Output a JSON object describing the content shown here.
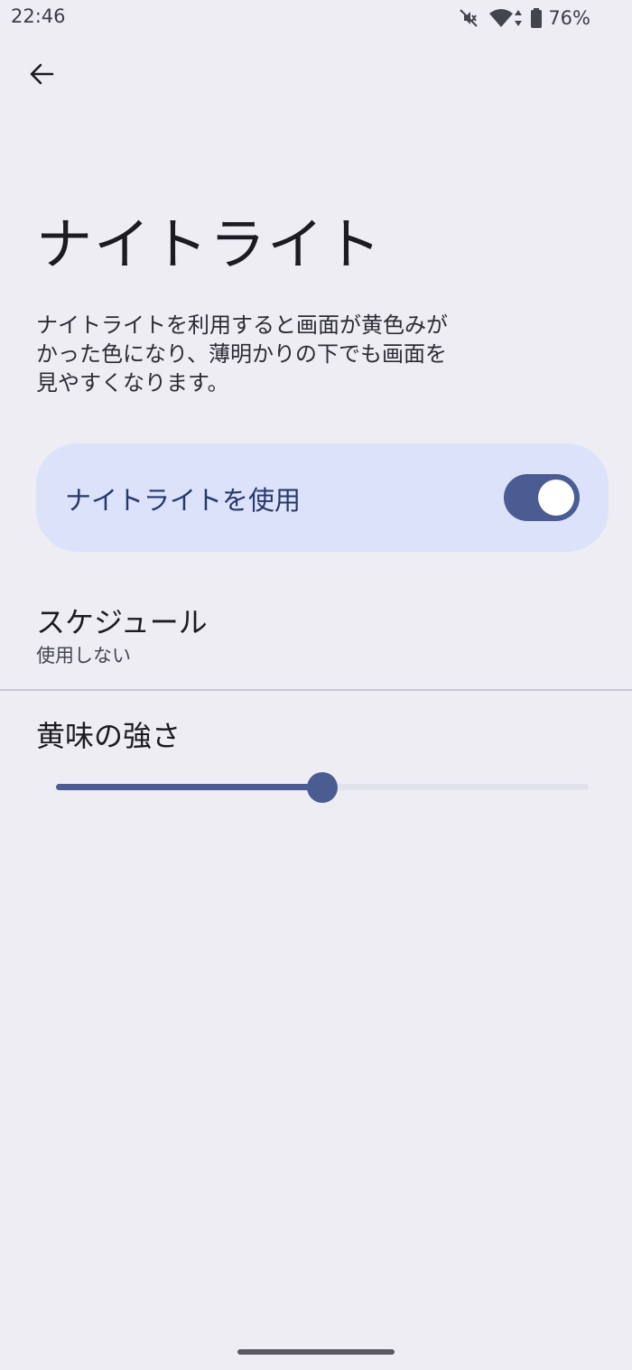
{
  "status_bar": {
    "time": "22:46",
    "battery": "76%",
    "icons": [
      "mute-icon",
      "wifi-icon",
      "data-arrows-icon",
      "battery-icon"
    ]
  },
  "header": {
    "back_icon": "arrow-back-icon",
    "title": "ナイトライト"
  },
  "description": {
    "lines": [
      "ナイトライトを利用すると画面が黄色みが",
      "かった色になり、薄明かりの下でも画面を",
      "見やすくなります。"
    ]
  },
  "night_light_toggle": {
    "label": "ナイトライトを使用",
    "checked": true
  },
  "schedule": {
    "title": "スケジュール",
    "value": "使用しない"
  },
  "intensity": {
    "title": "黄味の強さ",
    "level": 0.5
  },
  "colors": {
    "background": "#eeedf4",
    "accent": "#4a5c92",
    "card": "#dbe2fa",
    "card_text": "#28386a"
  }
}
